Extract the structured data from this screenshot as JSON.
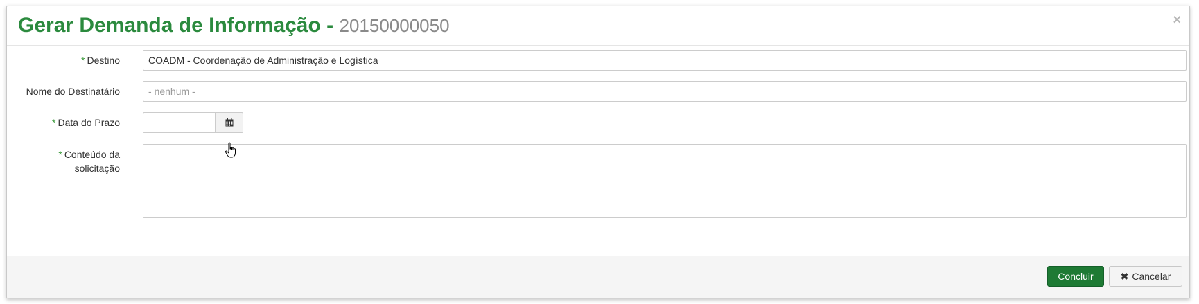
{
  "modal": {
    "title": "Gerar Demanda de Informação -",
    "title_number": "20150000050",
    "close_glyph": "×"
  },
  "form": {
    "destino": {
      "label": "Destino",
      "required_mark": "*",
      "value": "COADM - Coordenação de Administração e Logística"
    },
    "nome_destinatario": {
      "label": "Nome do Destinatário",
      "placeholder": "- nenhum -"
    },
    "data_prazo": {
      "label": "Data do Prazo",
      "required_mark": "*",
      "value": "",
      "button_icon": "calendar-icon"
    },
    "conteudo": {
      "label_line1": "Conteúdo da",
      "label_line2": "solicitação",
      "required_mark": "*",
      "value": ""
    }
  },
  "footer": {
    "submit_label": "Concluir",
    "cancel_label": "Cancelar",
    "cancel_icon": "close-icon"
  },
  "colors": {
    "title_green": "#2b8a3e",
    "primary_button": "#1e7a34",
    "required_mark": "#3a9a3a"
  }
}
